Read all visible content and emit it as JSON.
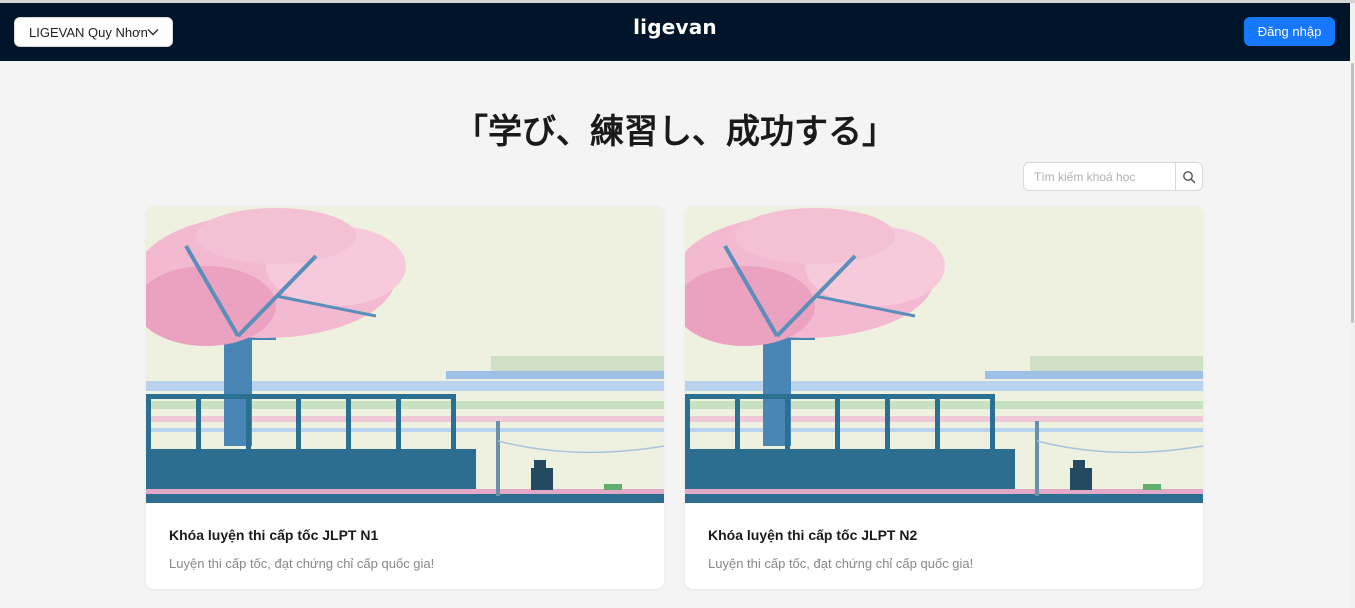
{
  "header": {
    "branch_select": {
      "value": "LIGEVAN Quy Nhơn",
      "icon": "chevron-down-icon"
    },
    "logo": "ligevan",
    "login_label": "Đăng nhập",
    "background": "#001529",
    "accent": "#1677ff"
  },
  "hero": {
    "title": "「学び、練習し、成功する」"
  },
  "search": {
    "placeholder": "Tìm kiếm khoá học",
    "value": "",
    "icon": "search-icon"
  },
  "courses": [
    {
      "title": "Khóa luyện thi cấp tốc JLPT N1",
      "description": "Luyện thi cấp tốc, đạt chứng chỉ cấp quốc gia!"
    },
    {
      "title": "Khóa luyện thi cấp tốc JLPT N2",
      "description": "Luyện thi cấp tốc, đạt chứng chỉ cấp quốc gia!"
    }
  ]
}
